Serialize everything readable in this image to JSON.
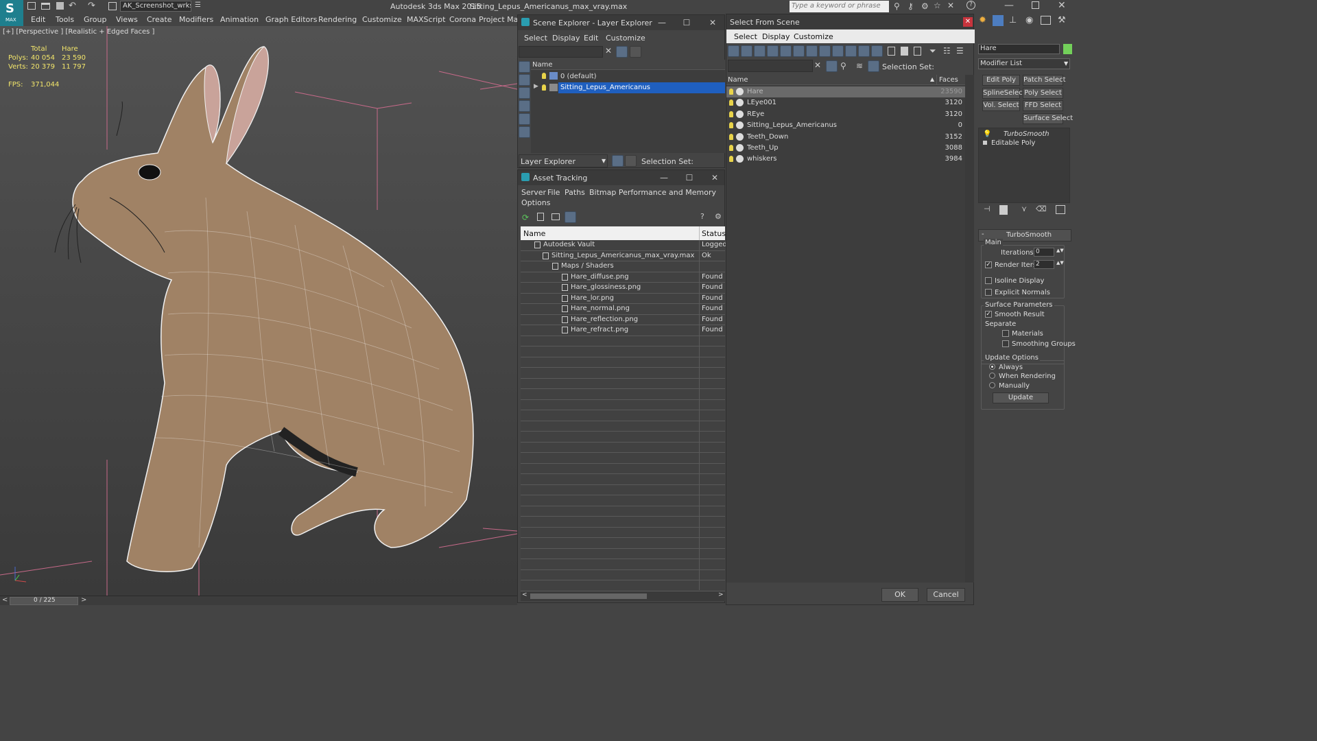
{
  "title": {
    "workspace": "AK_Screenshot_wrksp",
    "app": "Autodesk 3ds Max  2015",
    "file": "Sitting_Lepus_Americanus_max_vray.max",
    "search_placeholder": "Type a keyword or phrase"
  },
  "menu": [
    "Edit",
    "Tools",
    "Group",
    "Views",
    "Create",
    "Modifiers",
    "Animation",
    "Graph Editors",
    "Rendering",
    "Customize",
    "MAXScript",
    "Corona",
    "Project Man"
  ],
  "viewport": {
    "label": "[+] [Perspective ] [Realistic + Edged Faces ]",
    "stats": {
      "header_total": "Total",
      "header_obj": "Hare",
      "polys_label": "Polys:",
      "polys_total": "40 054",
      "polys_obj": "23 590",
      "verts_label": "Verts:",
      "verts_total": "20 379",
      "verts_obj": "11 797",
      "fps_label": "FPS:",
      "fps_value": "371,044"
    },
    "timeline": "0 / 225"
  },
  "scene_explorer": {
    "title": "Scene Explorer - Layer Explorer",
    "menus": [
      "Select",
      "Display",
      "Edit",
      "Customize"
    ],
    "column": "Name",
    "layers": [
      "0 (default)",
      "Sitting_Lepus_Americanus"
    ],
    "footer_dropdown": "Layer Explorer",
    "selection_set": "Selection Set:"
  },
  "asset_tracking": {
    "title": "Asset Tracking",
    "menus": [
      "Server",
      "File",
      "Paths",
      "Bitmap Performance and Memory"
    ],
    "menu2": "Options",
    "col_name": "Name",
    "col_status": "Status",
    "rows": [
      {
        "name": "Autodesk Vault",
        "status": "Logged"
      },
      {
        "name": "Sitting_Lepus_Americanus_max_vray.max",
        "status": "Ok"
      },
      {
        "name": "Maps / Shaders",
        "status": ""
      },
      {
        "name": "Hare_diffuse.png",
        "status": "Found"
      },
      {
        "name": "Hare_glossiness.png",
        "status": "Found"
      },
      {
        "name": "Hare_lor.png",
        "status": "Found"
      },
      {
        "name": "Hare_normal.png",
        "status": "Found"
      },
      {
        "name": "Hare_reflection.png",
        "status": "Found"
      },
      {
        "name": "Hare_refract.png",
        "status": "Found"
      }
    ]
  },
  "select_from_scene": {
    "title": "Select From Scene",
    "menus": [
      "Select",
      "Display",
      "Customize"
    ],
    "selection_set": "Selection Set:",
    "col_name": "Name",
    "col_faces": "Faces",
    "objects": [
      {
        "name": "Hare",
        "faces": "23590"
      },
      {
        "name": "LEye001",
        "faces": "3120"
      },
      {
        "name": "REye",
        "faces": "3120"
      },
      {
        "name": "Sitting_Lepus_Americanus",
        "faces": "0"
      },
      {
        "name": "Teeth_Down",
        "faces": "3152"
      },
      {
        "name": "Teeth_Up",
        "faces": "3088"
      },
      {
        "name": "whiskers",
        "faces": "3984"
      }
    ],
    "ok": "OK",
    "cancel": "Cancel"
  },
  "command_panel": {
    "object_name": "Hare",
    "modifier_list": "Modifier List",
    "buttons": [
      "Edit Poly",
      "Patch Select",
      "SplineSelect",
      "Poly Select",
      "Vol. Select",
      "FFD Select",
      "Surface Select"
    ],
    "stack": [
      "TurboSmooth",
      "Editable Poly"
    ],
    "rollout_title": "TurboSmooth",
    "main": "Main",
    "iterations_label": "Iterations:",
    "iterations_value": "0",
    "render_iters_label": "Render Iters:",
    "render_iters_value": "2",
    "isoline": "Isoline Display",
    "explicit": "Explicit Normals",
    "surface_params": "Surface Parameters",
    "smooth_result": "Smooth Result",
    "separate": "Separate",
    "materials": "Materials",
    "smoothing_groups": "Smoothing Groups",
    "update_options": "Update Options",
    "always": "Always",
    "when_rendering": "When Rendering",
    "manually": "Manually",
    "update": "Update"
  }
}
